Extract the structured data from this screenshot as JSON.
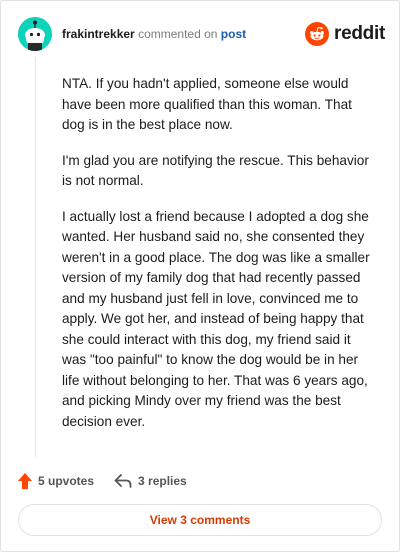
{
  "comment": {
    "author": "frakintrekker",
    "action_text": "commented on",
    "post_link": "post",
    "paragraphs": [
      "NTA. If you hadn't applied, someone else would have been more qualified than this woman. That dog is in the best place now.",
      "I'm glad you are notifying the rescue. This behavior is not normal.",
      "I actually lost a friend because I adopted a dog she wanted. Her husband said no, she consented they weren't in a good place. The dog was like a smaller version of my family dog that had recently passed and my husband just fell in love, convinced me to apply. We got her, and instead of being happy that she could interact with this dog, my friend said it was \"too painful\" to know the dog would be in her life without belonging to her. That was 6 years ago, and picking Mindy over my friend was the best decision ever."
    ]
  },
  "brand": {
    "name": "reddit",
    "icon": "reddit-logo-icon",
    "color": "#ff4500"
  },
  "footer": {
    "upvotes_label": "5 upvotes",
    "replies_label": "3 replies",
    "upvote_icon": "upvote-arrow-icon",
    "reply_icon": "reply-arrow-icon",
    "upvote_color": "#ff4500"
  },
  "view_comments_label": "View 3 comments",
  "colors": {
    "accent": "#d93a00",
    "link": "#1a5db4",
    "avatar_bg": "#0dd3bb"
  }
}
